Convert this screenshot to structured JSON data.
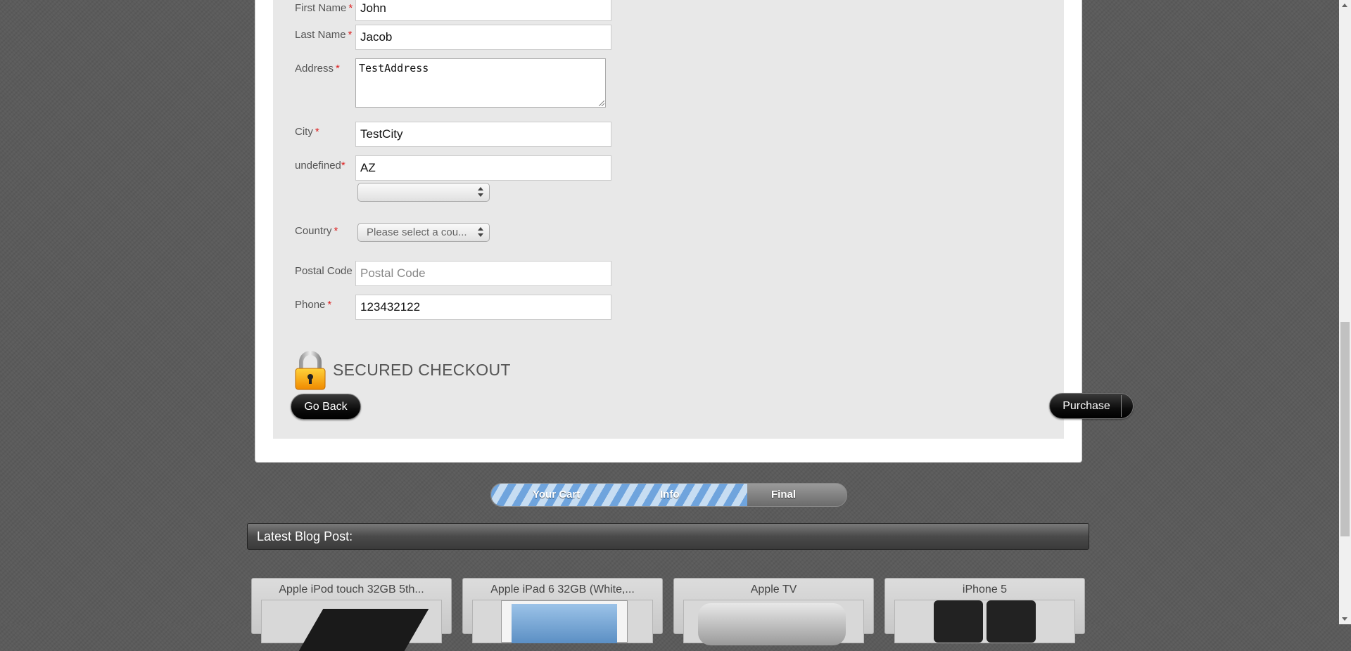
{
  "form": {
    "first_name": {
      "label": "First Name",
      "required": "*",
      "value": "John"
    },
    "last_name": {
      "label": "Last Name",
      "required": "*",
      "value": "Jacob"
    },
    "address": {
      "label": "Address",
      "required": "*",
      "value": "TestAddress"
    },
    "city": {
      "label": "City",
      "required": "*",
      "value": "TestCity"
    },
    "state": {
      "label": "undefined",
      "required": "*",
      "value": "AZ",
      "select_value": ""
    },
    "country": {
      "label": "Country",
      "required": "*",
      "select_value": "Please select a cou..."
    },
    "postal_code": {
      "label": "Postal Code",
      "placeholder": "Postal Code"
    },
    "phone": {
      "label": "Phone",
      "required": "*",
      "value": "123432122"
    }
  },
  "secured": {
    "text": "SECURED CHECKOUT",
    "icon": "padlock-icon"
  },
  "buttons": {
    "go_back": "Go Back",
    "purchase": "Purchase"
  },
  "progress": {
    "steps": [
      "Your Cart",
      "Info",
      "Final"
    ],
    "completed_fraction": 0.72
  },
  "blog": {
    "title": "Latest Blog Post:"
  },
  "products": [
    {
      "name": "Apple iPod touch 32GB 5th..."
    },
    {
      "name": "Apple iPad 6 32GB (White,..."
    },
    {
      "name": "Apple TV"
    },
    {
      "name": "iPhone 5"
    }
  ],
  "colors": {
    "required": "#dd2222",
    "progress_stripe": "#6fa4dd",
    "button": "#111111"
  }
}
